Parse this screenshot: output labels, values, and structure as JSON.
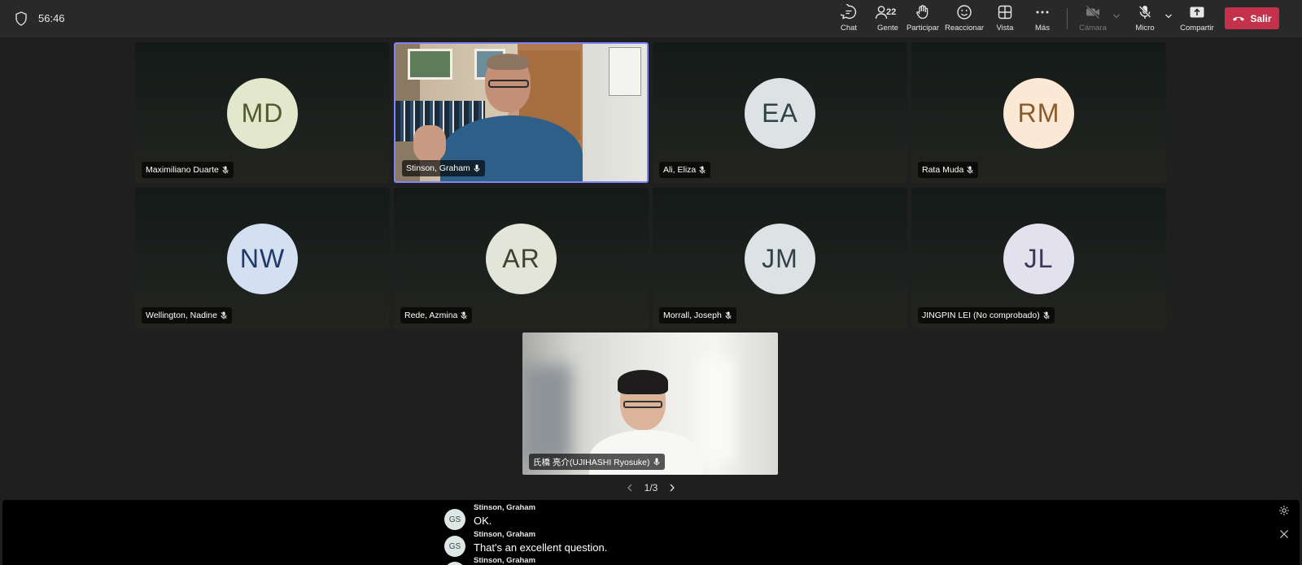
{
  "topbar": {
    "timer": "56:46",
    "buttons": {
      "chat": "Chat",
      "people": "Gente",
      "people_count": "22",
      "raise_hand": "Participar",
      "react": "Reaccionar",
      "view": "Vista",
      "more": "Más",
      "camera": "Cámara",
      "mic": "Micro",
      "share": "Compartir",
      "leave": "Salir"
    },
    "colors": {
      "leave": "#c4314b",
      "active_border": "#7f85f5"
    }
  },
  "tiles": [
    {
      "initials": "MD",
      "name": "Maximiliano Duarte",
      "avatar_bg": "#e3e7cc",
      "avatar_fg": "#4f5a2e",
      "icon": "mic-off-icon"
    },
    {
      "initials": "",
      "name": "Stinson, Graham",
      "video": true,
      "active": true,
      "icon": "mic-icon"
    },
    {
      "initials": "EA",
      "name": "Ali, Eliza",
      "avatar_bg": "#dde3e4",
      "avatar_fg": "#2f4346",
      "icon": "mic-off-icon"
    },
    {
      "initials": "RM",
      "name": "Rata Muda",
      "avatar_bg": "#fbe8d5",
      "avatar_fg": "#8b5a2b",
      "icon": "mic-off-icon"
    },
    {
      "initials": "NW",
      "name": "Wellington, Nadine",
      "avatar_bg": "#d4e0f2",
      "avatar_fg": "#1f3a68",
      "icon": "mic-off-icon"
    },
    {
      "initials": "AR",
      "name": "Rede, Azmina",
      "avatar_bg": "#e3e5d9",
      "avatar_fg": "#3e4231",
      "icon": "mic-off-icon"
    },
    {
      "initials": "JM",
      "name": "Morrall, Joseph",
      "avatar_bg": "#dde3e4",
      "avatar_fg": "#2f4346",
      "icon": "mic-off-icon"
    },
    {
      "initials": "JL",
      "name": "JINGPIN LEI (No comprobado)",
      "avatar_bg": "#e4e1ee",
      "avatar_fg": "#3c3559",
      "icon": "mic-off-icon"
    }
  ],
  "featured": {
    "name": "氏橋 亮介(UJIHASHI Ryosuke)",
    "icon": "mic-icon"
  },
  "pager": {
    "label": "1/3"
  },
  "captions": [
    {
      "initials": "GS",
      "speaker": "Stinson, Graham",
      "text": "OK."
    },
    {
      "initials": "GS",
      "speaker": "Stinson, Graham",
      "text": "That's an excellent question."
    },
    {
      "initials": "GS",
      "speaker": "Stinson, Graham",
      "text": ""
    }
  ]
}
